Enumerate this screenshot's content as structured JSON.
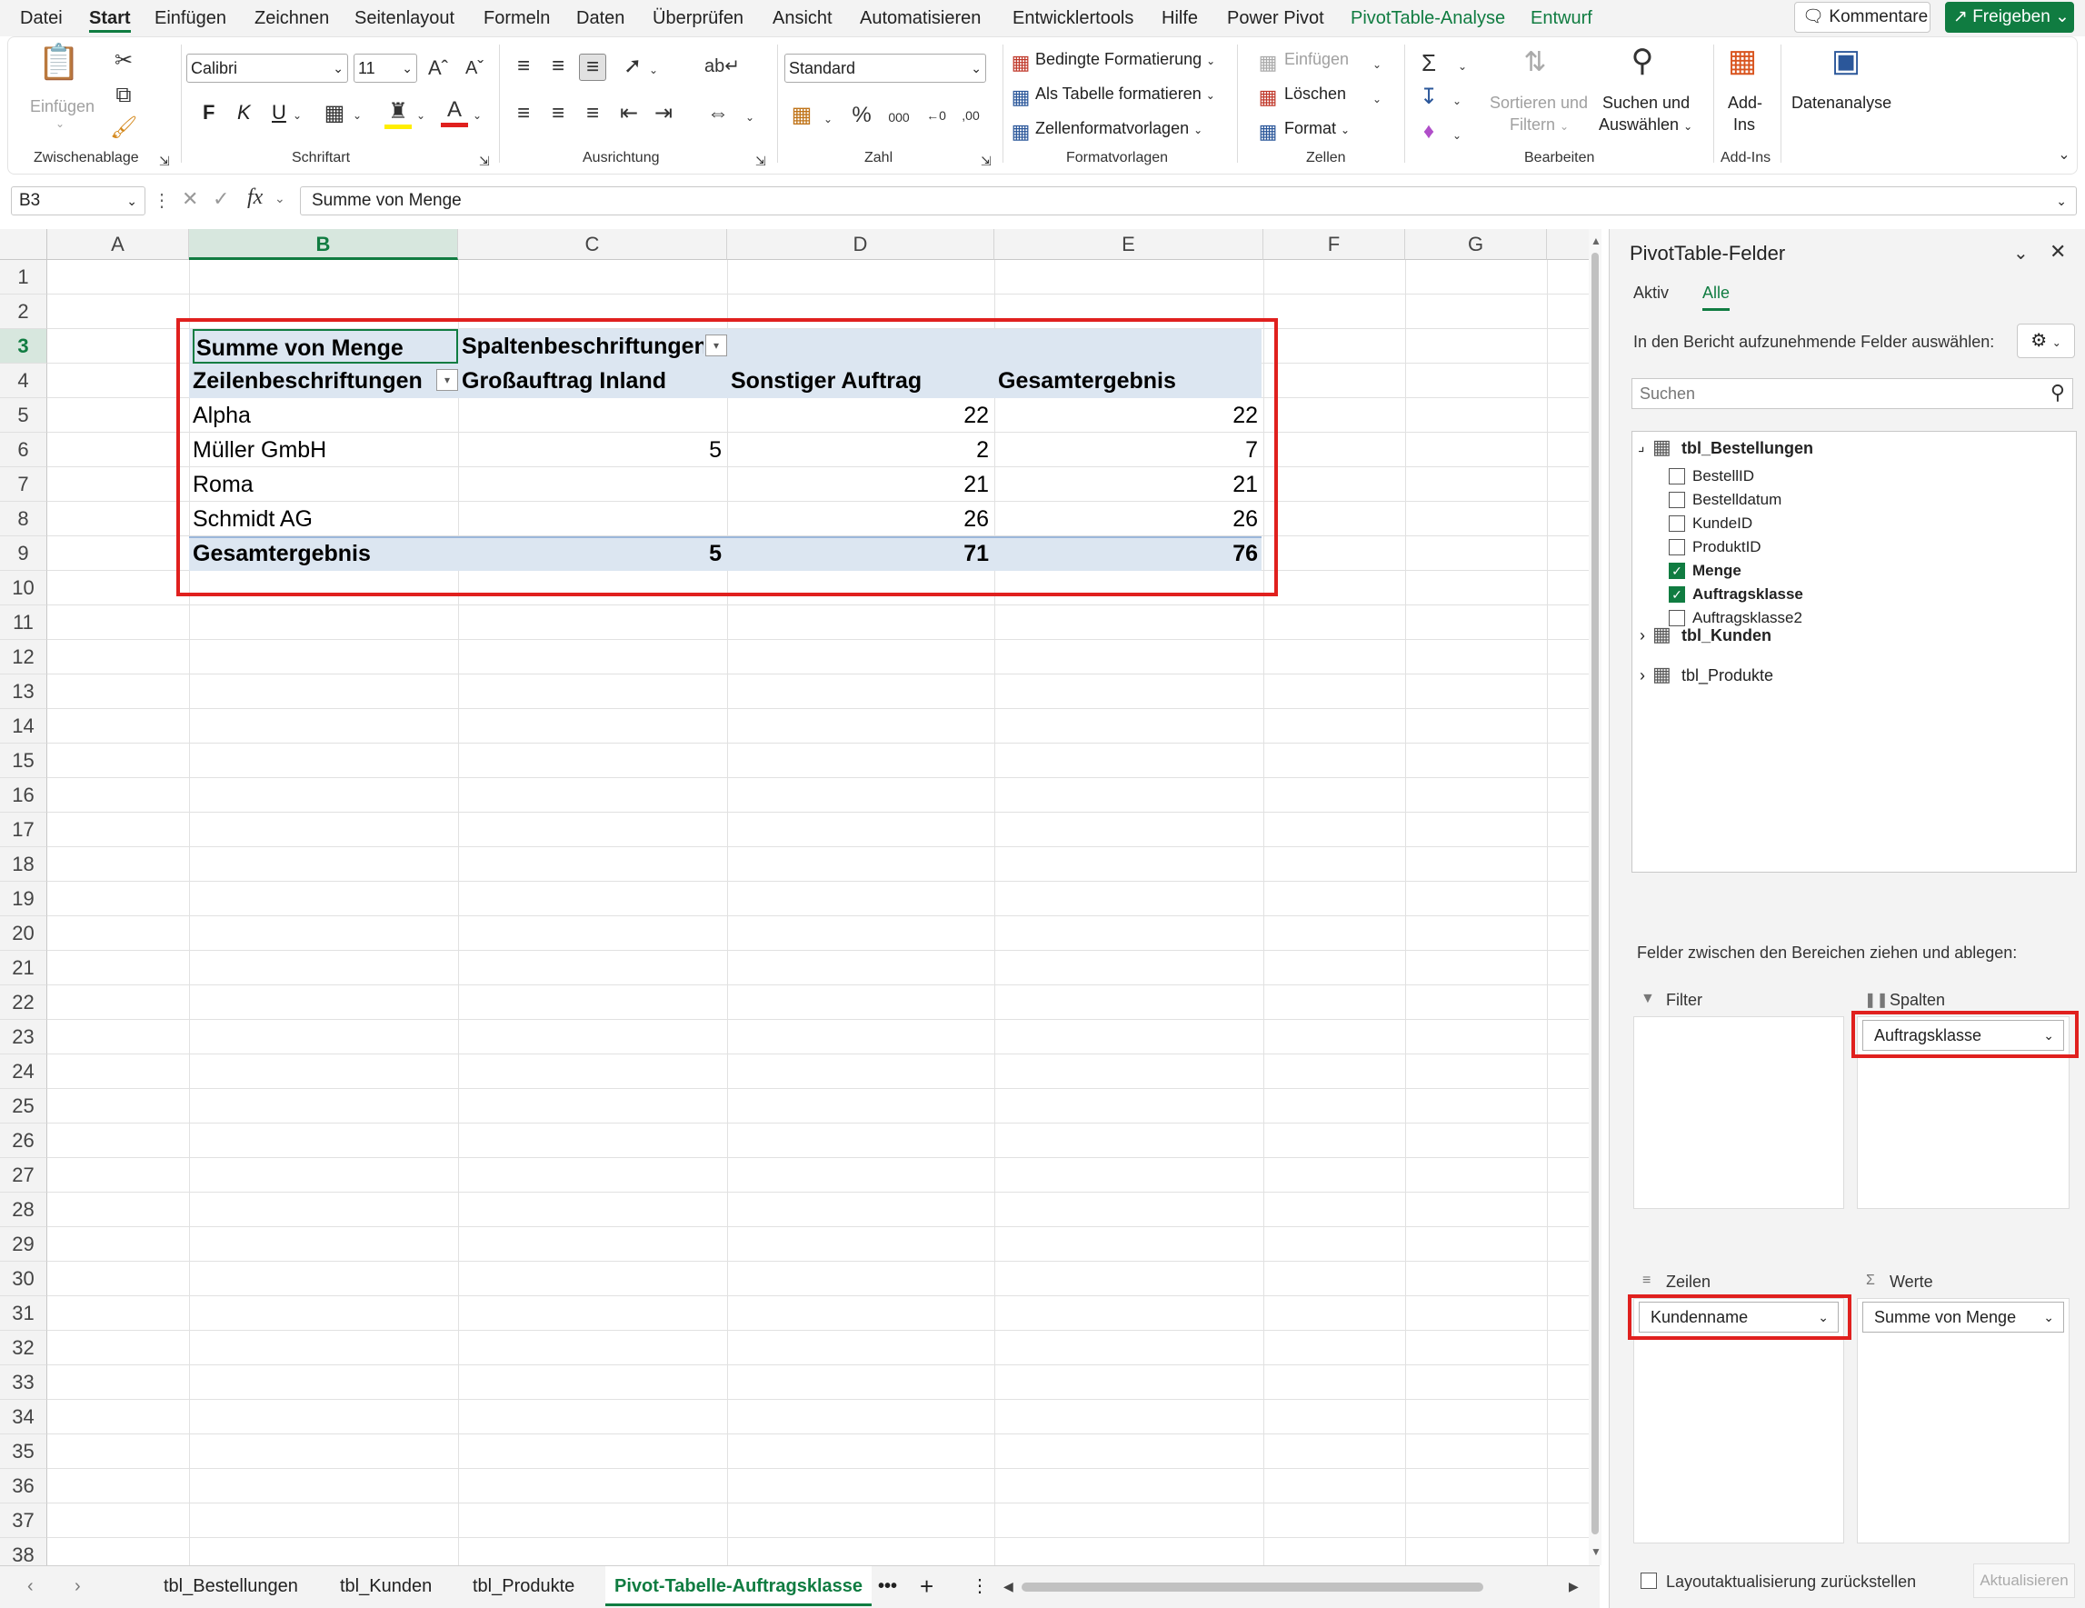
{
  "menubar": {
    "tabs": [
      "Datei",
      "Start",
      "Einfügen",
      "Zeichnen",
      "Seitenlayout",
      "Formeln",
      "Daten",
      "Überprüfen",
      "Ansicht",
      "Automatisieren",
      "Entwicklertools",
      "Hilfe",
      "Power Pivot",
      "PivotTable-Analyse",
      "Entwurf"
    ],
    "comments": "Kommentare",
    "share": "Freigeben"
  },
  "ribbon": {
    "clipboard": {
      "paste": "Einfügen",
      "label": "Zwischenablage"
    },
    "font": {
      "name": "Calibri",
      "size": "11",
      "bold": "F",
      "italic": "K",
      "underline": "U",
      "label": "Schriftart"
    },
    "alignment": {
      "label": "Ausrichtung"
    },
    "number": {
      "format": "Standard",
      "label": "Zahl"
    },
    "styles": {
      "conditional": "Bedingte Formatierung",
      "as_table": "Als Tabelle formatieren",
      "cell_styles": "Zellenformatvorlagen",
      "label": "Formatvorlagen"
    },
    "cells": {
      "insert": "Einfügen",
      "delete": "Löschen",
      "format": "Format",
      "label": "Zellen"
    },
    "editing": {
      "sort": "Sortieren und",
      "sort2": "Filtern",
      "find": "Suchen und",
      "find2": "Auswählen",
      "label": "Bearbeiten"
    },
    "addins": {
      "addins": "Add-",
      "addins2": "Ins",
      "label": "Add-Ins"
    },
    "analysis": {
      "label": "Datenanalyse"
    }
  },
  "formula": {
    "namebox": "B3",
    "content": "Summe von Menge"
  },
  "grid": {
    "columns": [
      "A",
      "B",
      "C",
      "D",
      "E",
      "F",
      "G"
    ],
    "rows": [
      "1",
      "2",
      "3",
      "4",
      "5",
      "6",
      "7",
      "8",
      "9",
      "10",
      "11",
      "12",
      "13",
      "14",
      "15",
      "16",
      "17",
      "18",
      "19",
      "20",
      "21",
      "22",
      "23",
      "24",
      "25",
      "26",
      "27",
      "28",
      "29",
      "30",
      "31",
      "32",
      "33",
      "34",
      "35",
      "36",
      "37",
      "38"
    ]
  },
  "pivot": {
    "value_header": "Summe von Menge",
    "col_labels_header": "Spaltenbeschriftungen",
    "row_labels_header": "Zeilenbeschriftungen",
    "col_headers": [
      "Großauftrag Inland",
      "Sonstiger Auftrag",
      "Gesamtergebnis"
    ],
    "rows": [
      {
        "name": "Alpha",
        "c1": "",
        "c2": "22",
        "total": "22"
      },
      {
        "name": "Müller GmbH",
        "c1": "5",
        "c2": "2",
        "total": "7"
      },
      {
        "name": "Roma",
        "c1": "",
        "c2": "21",
        "total": "21"
      },
      {
        "name": "Schmidt AG",
        "c1": "",
        "c2": "26",
        "total": "26"
      }
    ],
    "grand": {
      "name": "Gesamtergebnis",
      "c1": "5",
      "c2": "71",
      "total": "76"
    }
  },
  "sheets": {
    "tabs": [
      "tbl_Bestellungen",
      "tbl_Kunden",
      "tbl_Produkte",
      "Pivot-Tabelle-Auftragsklasse"
    ],
    "more": "•••",
    "add": "+"
  },
  "pane": {
    "title": "PivotTable-Felder",
    "tab_active": "Aktiv",
    "tab_all": "Alle",
    "instruction": "In den Bericht aufzunehmende Felder auswählen:",
    "search_placeholder": "Suchen",
    "tables": {
      "t1": "tbl_Bestellungen",
      "t2": "tbl_Kunden",
      "t3": "tbl_Produkte"
    },
    "fields": [
      {
        "name": "BestellID",
        "checked": false
      },
      {
        "name": "Bestelldatum",
        "checked": false
      },
      {
        "name": "KundeID",
        "checked": false
      },
      {
        "name": "ProduktID",
        "checked": false
      },
      {
        "name": "Menge",
        "checked": true
      },
      {
        "name": "Auftragsklasse",
        "checked": true
      },
      {
        "name": "Auftragsklasse2",
        "checked": false
      }
    ],
    "drag_hint": "Felder zwischen den Bereichen ziehen und ablegen:",
    "areas": {
      "filter": "Filter",
      "columns": "Spalten",
      "rows": "Zeilen",
      "values": "Werte",
      "columns_field": "Auftragsklasse",
      "rows_field": "Kundenname",
      "values_field": "Summe von Menge"
    },
    "defer": "Layoutaktualisierung zurückstellen",
    "update": "Aktualisieren"
  },
  "colors": {
    "accent": "#107c41",
    "pivot_band": "#dce6f1",
    "highlight": "#e0201e"
  }
}
